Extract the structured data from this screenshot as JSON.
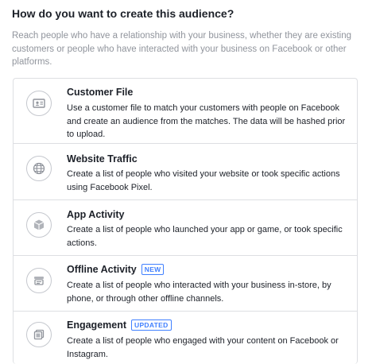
{
  "header": {
    "title": "How do you want to create this audience?",
    "description": "Reach people who have a relationship with your business, whether they are existing customers or people who have interacted with your business on Facebook or other platforms."
  },
  "options": [
    {
      "title": "Customer File",
      "description": "Use a customer file to match your customers with people on Facebook and create an audience from the matches. The data will be hashed prior to upload.",
      "icon": "contact-card-icon"
    },
    {
      "title": "Website Traffic",
      "description": "Create a list of people who visited your website or took specific actions using Facebook Pixel.",
      "icon": "globe-icon"
    },
    {
      "title": "App Activity",
      "description": "Create a list of people who launched your app or game, or took specific actions.",
      "icon": "cube-icon"
    },
    {
      "title": "Offline Activity",
      "badge": "NEW",
      "description": "Create a list of people who interacted with your business in-store, by phone, or through other offline channels.",
      "icon": "store-icon"
    },
    {
      "title": "Engagement",
      "badge": "UPDATED",
      "description": "Create a list of people who engaged with your content on Facebook or Instagram.",
      "icon": "engagement-icon"
    }
  ]
}
